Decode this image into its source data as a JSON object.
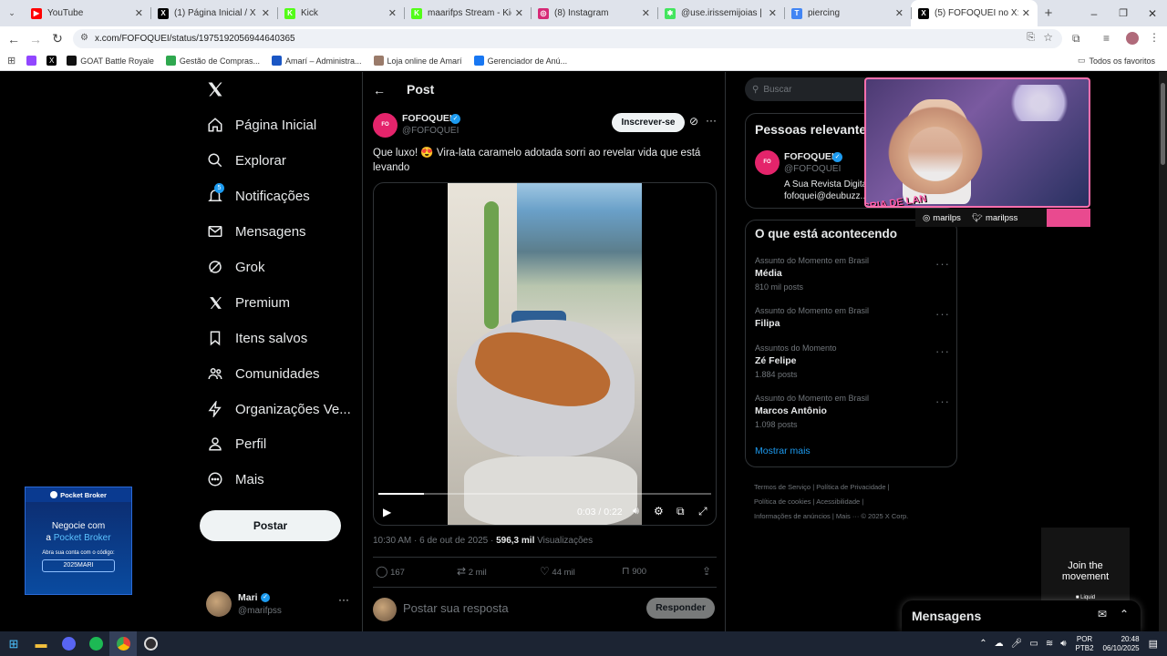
{
  "browser": {
    "tabs": [
      {
        "label": "YouTube",
        "color": "#ff0000",
        "glyph": "▶"
      },
      {
        "label": "(1) Página Inicial / X",
        "color": "#000000",
        "glyph": "X"
      },
      {
        "label": "Kick",
        "color": "#53fc18",
        "glyph": "K"
      },
      {
        "label": "maarifps Stream - Kick Da",
        "color": "#53fc18",
        "glyph": "K"
      },
      {
        "label": "(8) Instagram",
        "color": "#d62976",
        "glyph": "◎"
      },
      {
        "label": "@use.irissemijoias | Linkt",
        "color": "#43e55e",
        "glyph": "✱"
      },
      {
        "label": "piercing",
        "color": "#4285f4",
        "glyph": "T"
      },
      {
        "label": "(5) FOFOQUEI no X: \"Que",
        "color": "#000000",
        "glyph": "X"
      }
    ],
    "url": "x.com/FOFOQUEI/status/1975192056944640365",
    "bookmarks": [
      {
        "label": "GOAT Battle Royale",
        "color": "#111111"
      },
      {
        "label": "Gestão de Compras...",
        "color": "#2fa84f"
      },
      {
        "label": "Amarí – Administra...",
        "color": "#1a56c4"
      },
      {
        "label": "Loja online de Amarí",
        "color": "#9a7b6a"
      },
      {
        "label": "Gerenciador de Anú...",
        "color": "#1877f2"
      }
    ],
    "all_bookmarks": "Todos os favoritos"
  },
  "sidebar": {
    "items": [
      {
        "label": "Página Inicial",
        "icon": "home-icon"
      },
      {
        "label": "Explorar",
        "icon": "search-icon"
      },
      {
        "label": "Notificações",
        "icon": "bell-icon",
        "badge": "5"
      },
      {
        "label": "Mensagens",
        "icon": "mail-icon"
      },
      {
        "label": "Grok",
        "icon": "grok-icon"
      },
      {
        "label": "Premium",
        "icon": "x-logo-icon"
      },
      {
        "label": "Itens salvos",
        "icon": "bookmark-icon"
      },
      {
        "label": "Comunidades",
        "icon": "people-icon"
      },
      {
        "label": "Organizações Ve...",
        "icon": "lightning-icon"
      },
      {
        "label": "Perfil",
        "icon": "person-icon"
      },
      {
        "label": "Mais",
        "icon": "more-circle-icon"
      }
    ],
    "post_button": "Postar",
    "account": {
      "name": "Mari",
      "handle": "@marifpss"
    }
  },
  "ad": {
    "brand": "Pocket Broker",
    "headline1": "Negocie com",
    "headline2_prefix": "a",
    "headline2_brand": "Pocket Broker",
    "sub": "Abra sua conta com o código:",
    "code": "2025MARI"
  },
  "post": {
    "header": "Post",
    "author": "FOFOQUEI",
    "handle": "@FOFOQUEI",
    "subscribe": "Inscrever-se",
    "text": "Que luxo! 😍 Vira-lata caramelo adotada sorri ao revelar vida que está levando",
    "video_time": "0:03 / 0:22",
    "video_progress": 0.136,
    "time": "10:30 AM · 6 de out de 2025 · ",
    "views_count": "596,3 mil",
    "views_label": " Visualizações",
    "replies": "167",
    "reposts": "2 mil",
    "likes": "44 mil",
    "bookmarks": "900",
    "reply_placeholder": "Postar sua resposta",
    "reply_button": "Responder"
  },
  "right": {
    "search_placeholder": "Buscar",
    "relevant_title": "Pessoas relevantes",
    "relevant": {
      "name": "FOFOQUEI",
      "handle": "@FOFOQUEI",
      "bio1": "A Sua Revista Digital",
      "bio2": "fofoquei@deubuzz..."
    },
    "happening_title": "O que está acontecendo",
    "trends": [
      {
        "cat": "Assunto do Momento em Brasil",
        "name": "Média",
        "count": "810 mil posts"
      },
      {
        "cat": "Assunto do Momento em Brasil",
        "name": "Filipa",
        "count": ""
      },
      {
        "cat": "Assuntos do Momento",
        "name": "Zé Felipe",
        "count": "1.884 posts"
      },
      {
        "cat": "Assunto do Momento em Brasil",
        "name": "Marcos Antônio",
        "count": "1.098 posts"
      }
    ],
    "show_more": "Mostrar mais",
    "footer_line1": "Termos de Serviço  |  Política de Privacidade  |",
    "footer_line2": "Política de cookies  |  Acessibilidade  |",
    "footer_line3": "Informações de anúncios  |  Mais ···  © 2025 X Corp.",
    "messages": "Mensagens"
  },
  "overlay": {
    "instagram": "marilps",
    "twitter": "marilpss",
    "logo": "CRIA DE LAN",
    "join1": "Join the",
    "join2": "movement",
    "join_brand": "■ Liquid"
  },
  "taskbar": {
    "lang1": "POR",
    "lang2": "PTB2",
    "time": "20:48",
    "date": "06/10/2025"
  }
}
